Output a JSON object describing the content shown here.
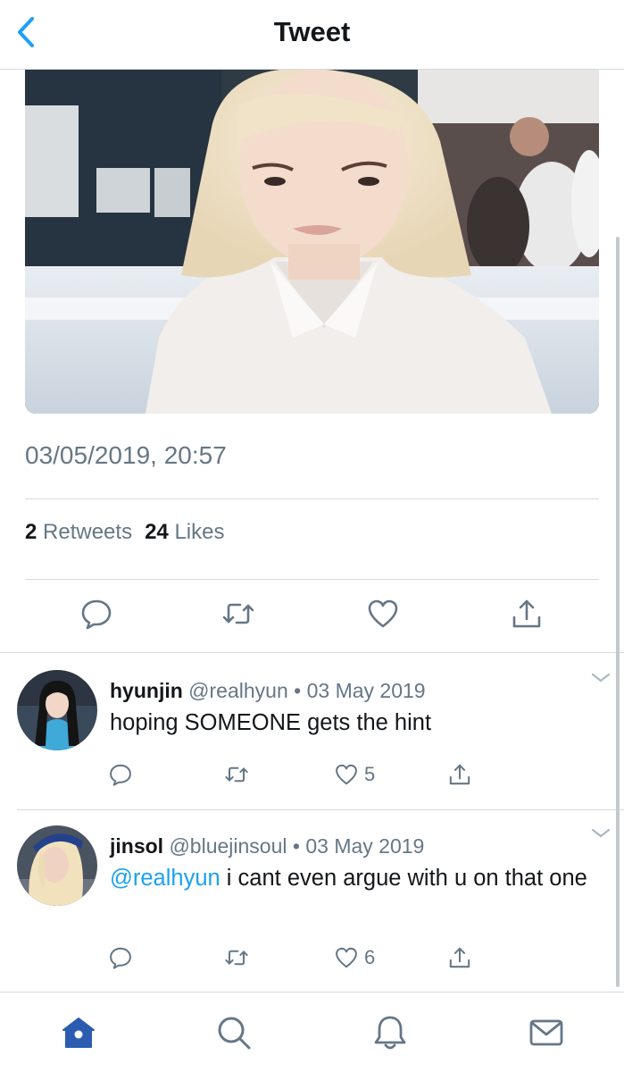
{
  "header": {
    "title": "Tweet"
  },
  "tweet": {
    "timestamp": "03/05/2019, 20:57",
    "retweet_count": "2",
    "retweet_label": "Retweets",
    "like_count": "24",
    "like_label": "Likes"
  },
  "replies": [
    {
      "name": "hyunjin",
      "handle": "@realhyun",
      "separator": "•",
      "date": "03 May 2019",
      "text": "hoping SOMEONE gets the hint",
      "like_count": "5"
    },
    {
      "name": "jinsol",
      "handle": "@bluejinsoul",
      "separator": "•",
      "date": "03 May 2019",
      "mention": "@realhyun",
      "text": "i cant even argue with u on that one",
      "like_count": "6"
    }
  ],
  "tabs": [
    "home-icon",
    "search-icon",
    "notifications-icon",
    "messages-icon"
  ],
  "colors": {
    "accent": "#1da1f2",
    "secondary_text": "#657786",
    "icon_gray": "#657786",
    "active_tab": "#2a5db0"
  }
}
